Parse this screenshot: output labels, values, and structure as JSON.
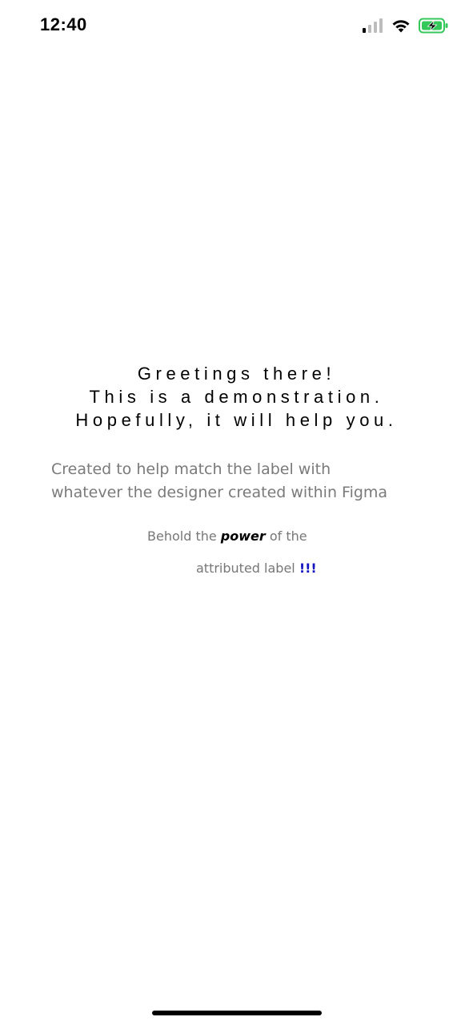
{
  "status_bar": {
    "time": "12:40",
    "icons": [
      "cellular-signal-icon",
      "wifi-icon",
      "battery-charging-icon"
    ],
    "battery_color": "#34c759"
  },
  "greeting": {
    "lines": [
      "Greetings there!",
      "This is a demonstration.",
      "Hopefully, it will help you."
    ]
  },
  "subtitle": {
    "lines": [
      "Created to help match the label with",
      "whatever the designer created within Figma"
    ]
  },
  "attributed_label": {
    "prefix": "Behold the",
    "emphasis": "power",
    "middle": "of the",
    "suffix": "attributed label",
    "exclamation": "!!!",
    "emphasis_color": "#000000",
    "exclamation_color": "#1515c0"
  }
}
